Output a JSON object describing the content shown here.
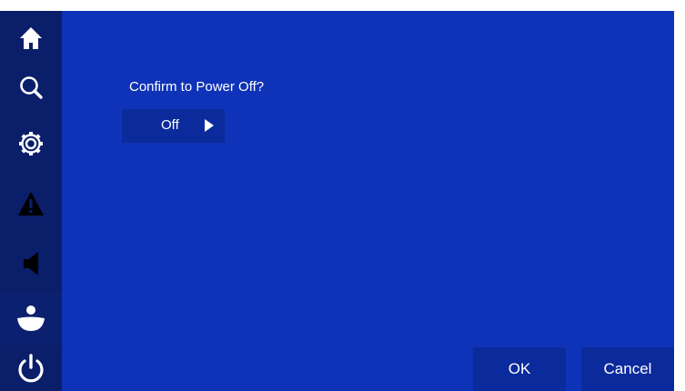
{
  "sidebar": {
    "items": [
      {
        "icon": "home-icon"
      },
      {
        "icon": "search-icon"
      },
      {
        "icon": "gear-icon"
      },
      {
        "icon": "warning-icon"
      },
      {
        "icon": "speaker-icon"
      },
      {
        "icon": "user-icon",
        "active": true
      },
      {
        "icon": "power-icon"
      }
    ]
  },
  "dialog": {
    "prompt": "Confirm to Power Off?",
    "selector_value": "Off"
  },
  "buttons": {
    "ok_label": "OK",
    "cancel_label": "Cancel"
  },
  "colors": {
    "background": "#0f33b8",
    "sidebar": "#0a1e6a",
    "button": "#0b2a9c",
    "text": "#ffffff"
  }
}
